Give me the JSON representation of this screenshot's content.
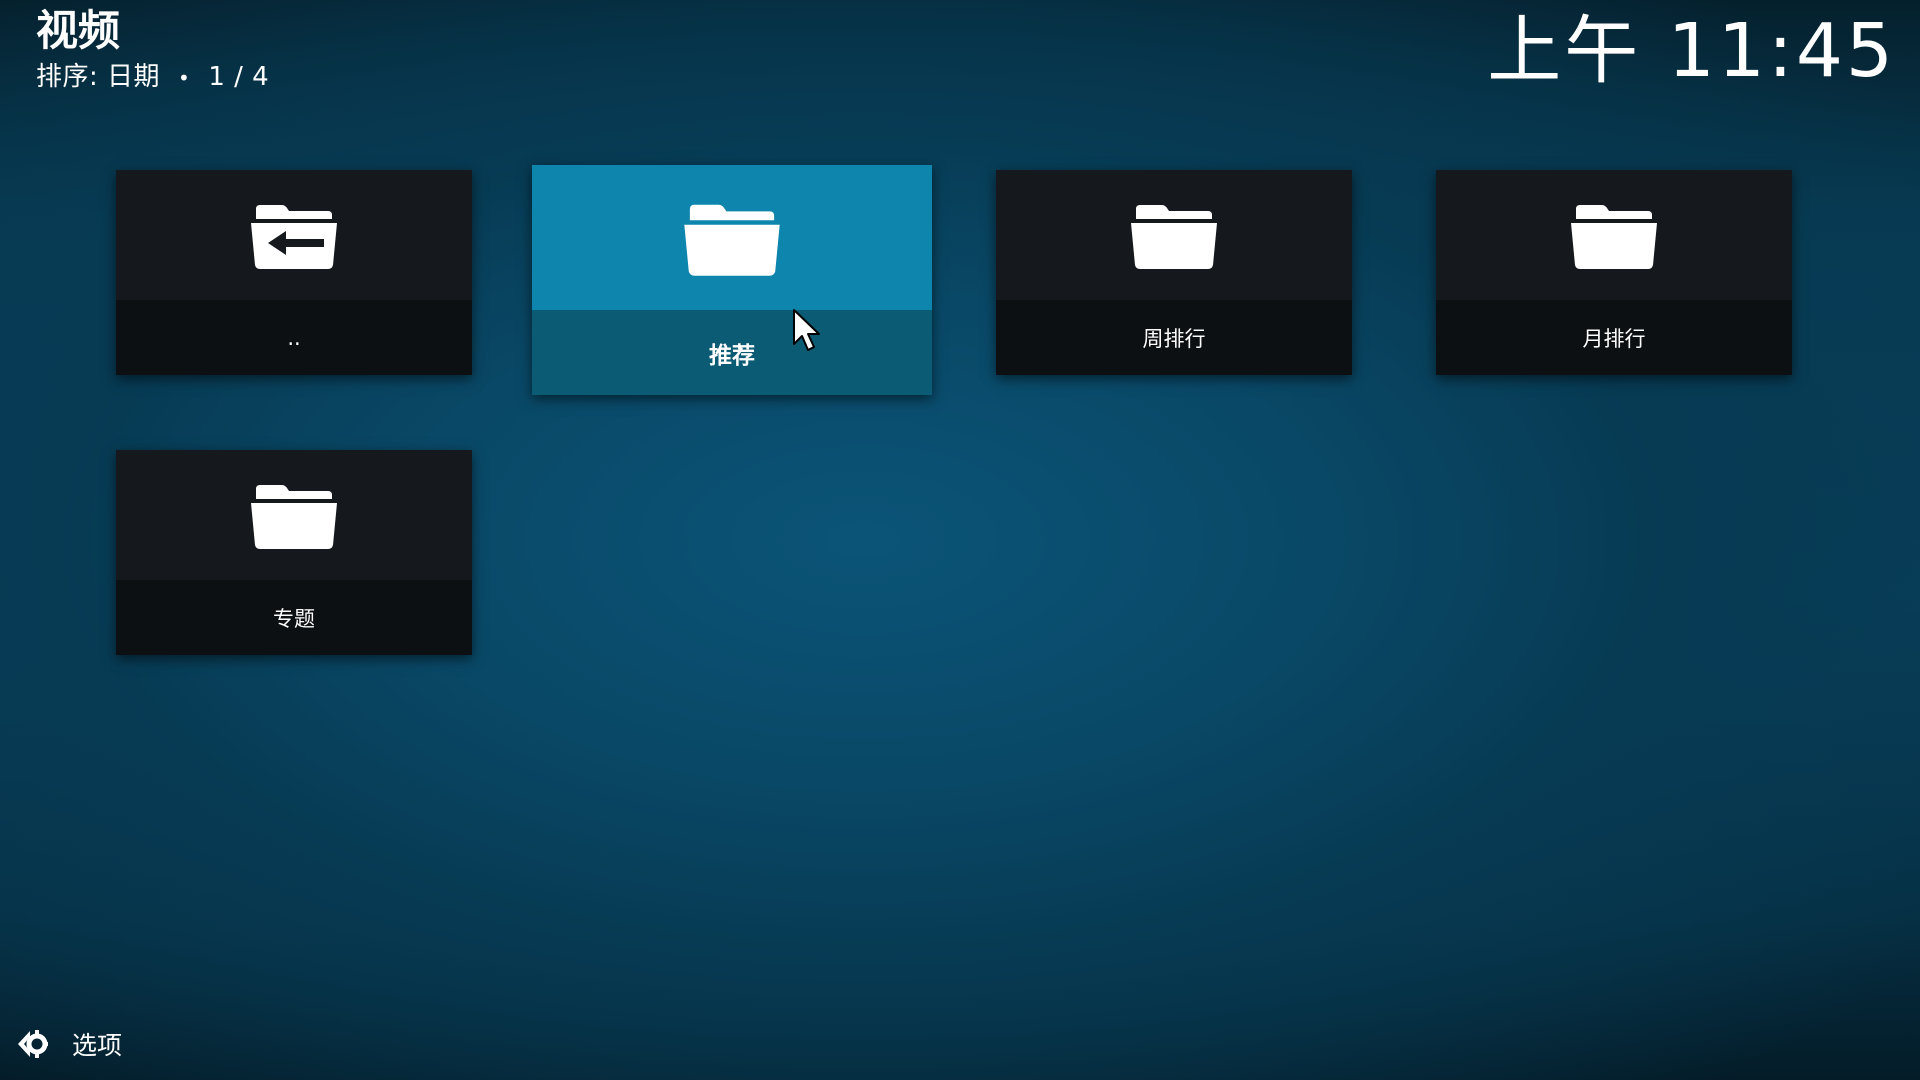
{
  "header": {
    "title": "视频",
    "sort_label": "排序: 日期",
    "separator": "•",
    "page_indicator": "1 / 4"
  },
  "clock": {
    "time": "上午 11:45"
  },
  "items": [
    {
      "label": "..",
      "icon": "folder-back-icon",
      "focused": false
    },
    {
      "label": "推荐",
      "icon": "folder-icon",
      "focused": true
    },
    {
      "label": "周排行",
      "icon": "folder-icon",
      "focused": false
    },
    {
      "label": "月排行",
      "icon": "folder-icon",
      "focused": false
    },
    {
      "label": "专题",
      "icon": "folder-icon",
      "focused": false
    }
  ],
  "footer": {
    "options_label": "选项",
    "icon": "options-gear-icon"
  },
  "colors": {
    "focus_accent": "#0e85ad",
    "focus_label_bg": "#0c5b74",
    "tile_bg": "#15191d",
    "tile_label_bg": "#0d1013",
    "background": "#08405c"
  }
}
